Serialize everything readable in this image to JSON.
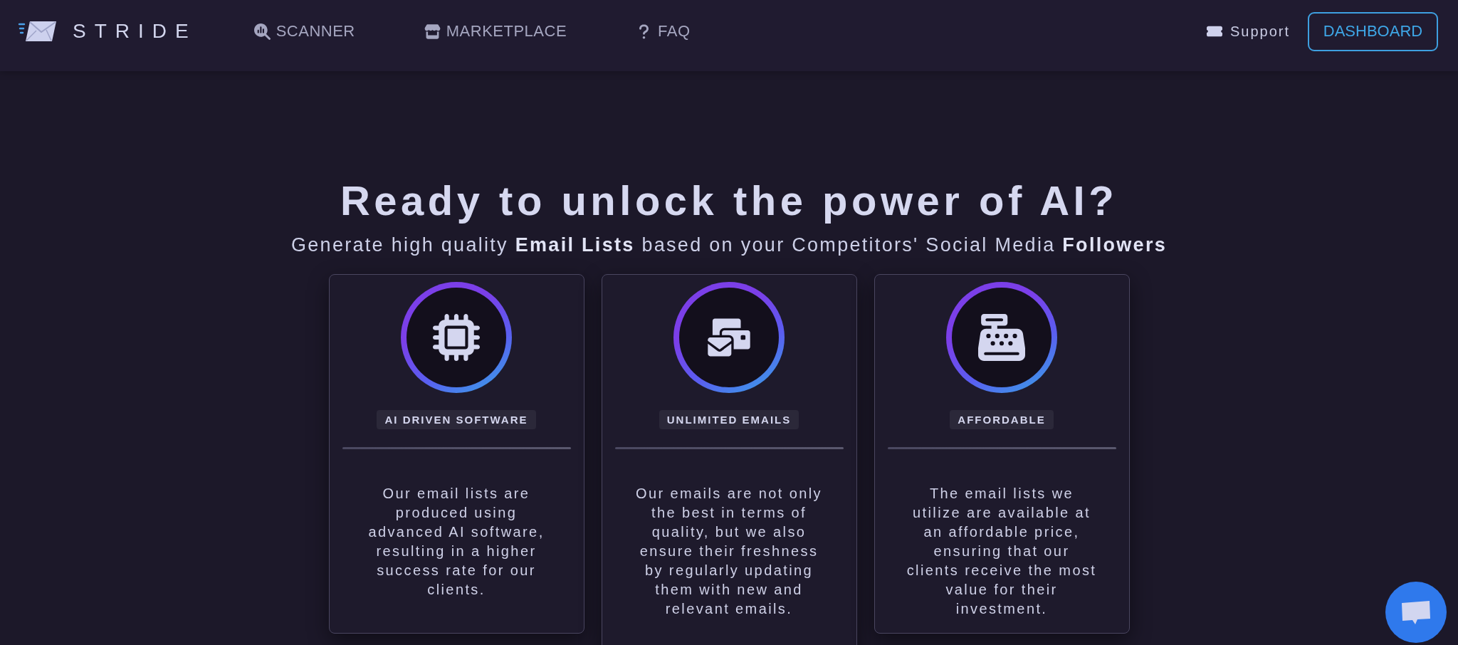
{
  "nav": {
    "brand": "STRIDE",
    "links": [
      {
        "label": "SCANNER"
      },
      {
        "label": "MARKETPLACE"
      },
      {
        "label": "FAQ"
      }
    ],
    "support": "Support",
    "dashboard_button": "DASHBOARD"
  },
  "hero": {
    "title": "Ready to unlock the power of AI?",
    "subtitle": "Generate high quality **Email Lists** based on your Competitors' Social Media **Followers**"
  },
  "features": [
    {
      "tag": "AI DRIVEN SOFTWARE",
      "text": "Our email lists are produced using advanced AI software, resulting in a higher success rate for our clients."
    },
    {
      "tag": "UNLIMITED EMAILS",
      "text": "Our emails are not only the best in terms of quality, but we also ensure their freshness by regularly updating them with new and relevant emails."
    },
    {
      "tag": "AFFORDABLE",
      "text": "The email lists we utilize are available at an affordable price, ensuring that our clients receive the most value for their investment."
    }
  ]
}
